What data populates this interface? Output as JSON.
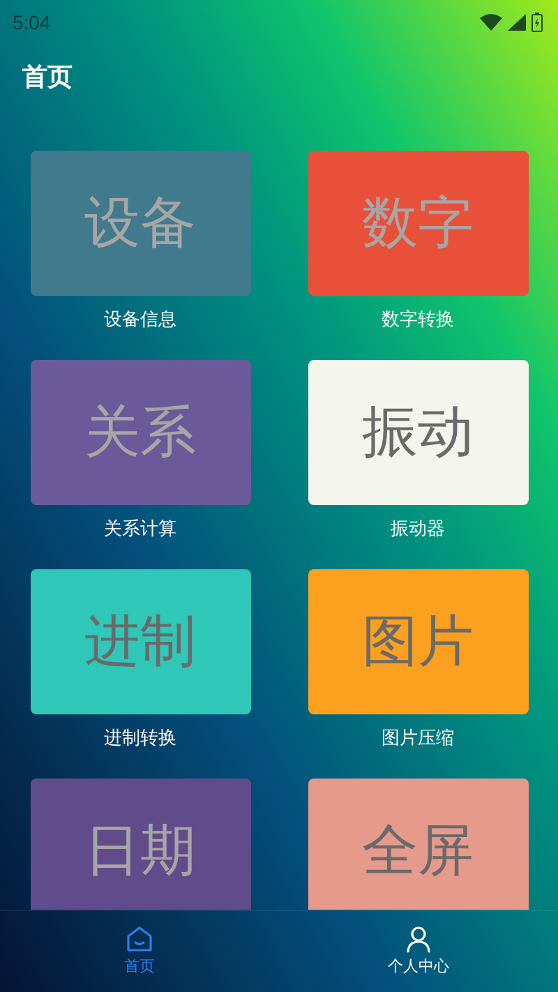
{
  "status_bar": {
    "time": "5:04"
  },
  "header": {
    "title": "首页"
  },
  "tiles": [
    {
      "tile_text": "设备",
      "label": "设备信息",
      "color": "#417a8c"
    },
    {
      "tile_text": "数字",
      "label": "数字转换",
      "color": "#e8503a"
    },
    {
      "tile_text": "关系",
      "label": "关系计算",
      "color": "#6a5a9a"
    },
    {
      "tile_text": "振动",
      "label": "振动器",
      "color": "#f4f5ec"
    },
    {
      "tile_text": "进制",
      "label": "进制转换",
      "color": "#2fc7b8"
    },
    {
      "tile_text": "图片",
      "label": "图片压缩",
      "color": "#fca01f"
    },
    {
      "tile_text": "日期",
      "color": "#604c8b"
    },
    {
      "tile_text": "全屏",
      "color": "#e59a8c"
    }
  ],
  "bottom_nav": [
    {
      "label": "首页",
      "kind": "home",
      "selected": true
    },
    {
      "label": "个人中心",
      "kind": "profile",
      "selected": false
    }
  ]
}
